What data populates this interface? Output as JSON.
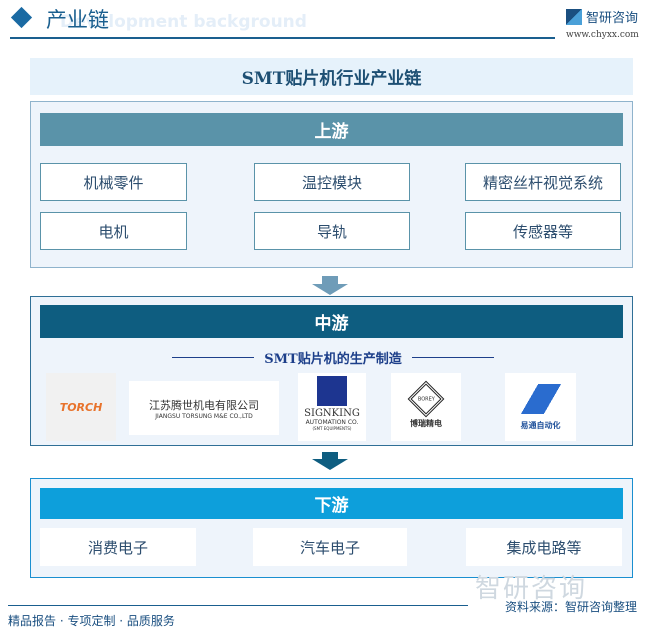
{
  "header": {
    "title": "产业链",
    "bg_text": "Development background",
    "brand": "智研咨询",
    "url": "www.chyxx.com"
  },
  "main_title": "SMT贴片机行业产业链",
  "upstream": {
    "label": "上游",
    "items": [
      "机械零件",
      "温控模块",
      "精密丝杆视觉系统",
      "电机",
      "导轨",
      "传感器等"
    ],
    "color": "#5a93a9"
  },
  "midstream": {
    "label": "中游",
    "subtitle": "SMT贴片机的生产制造",
    "color": "#0e5d80",
    "logos": [
      {
        "name": "TORCH"
      },
      {
        "name": "江苏腾世机电有限公司",
        "sub": "JIANGSU TORSUNG M&E CO.,LTD"
      },
      {
        "name": "SIGNKING",
        "sub": "AUTOMATION CO.",
        "sub2": "(SMT EQUIPMENTS)"
      },
      {
        "name": "博瑞精电",
        "sub": "BOREY"
      },
      {
        "name": "易通自动化"
      }
    ]
  },
  "downstream": {
    "label": "下游",
    "items": [
      "消费电子",
      "汽车电子",
      "集成电路等"
    ],
    "color": "#0d9fdb"
  },
  "footer": {
    "left": "精品报告 · 专项定制 · 品质服务",
    "source": "资料来源：智研咨询整理",
    "watermark": "智研咨询"
  }
}
